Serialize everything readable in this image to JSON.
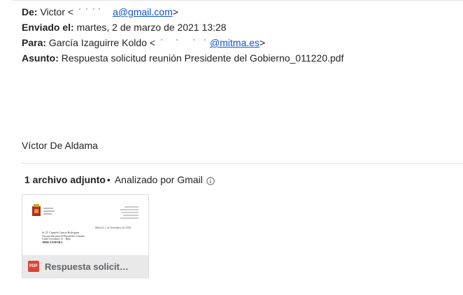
{
  "header": {
    "from_label": "De:",
    "from_name": "Victor <",
    "from_email_domain": "a@gmail.com",
    "from_close": ">",
    "sent_label": "Enviado el:",
    "sent_value": "martes, 2 de marzo de 2021 13:28",
    "to_label": "Para:",
    "to_name": "García Izaguirre Koldo <",
    "to_email_domain": "@mitma.es",
    "to_close": ">",
    "subject_label": "Asunto:",
    "subject_value": "Respuesta solicitud reunión Presidente del Gobierno_011220.pdf"
  },
  "signature": "Víctor De Aldama",
  "attachments": {
    "count_label": "1 archivo adjunto",
    "separator": "•",
    "scan_label": "Analizado por Gmail",
    "info_icon": "info-icon",
    "files": [
      {
        "name": "Respuesta solicit…",
        "type_badge": "PDF",
        "preview": {
          "city_date": "Madrid, 1 de diciembre de 2020",
          "addressee": "Sr. D. Carmelo Garcia Rodriguez",
          "association": "Asociación para el Desarrollo Canario",
          "street": "Calle Cervantes 11 - Bajo",
          "city": "38006 ZAMORA"
        }
      }
    ]
  },
  "colors": {
    "link": "#1155cc",
    "pdf_red": "#db4437",
    "text": "#222222"
  }
}
